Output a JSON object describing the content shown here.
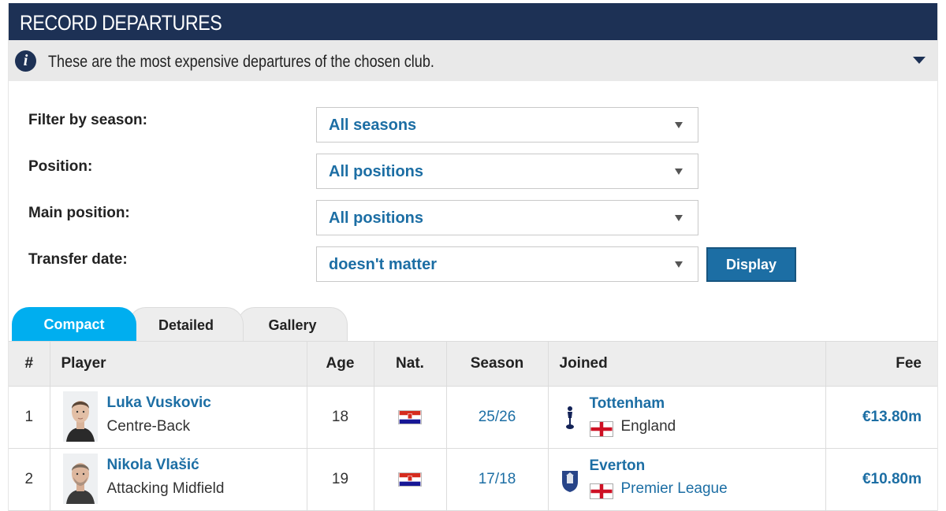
{
  "header": {
    "title": "RECORD DEPARTURES"
  },
  "info": {
    "icon": "info-icon",
    "text": "These are the most expensive departures of the chosen club."
  },
  "filters": [
    {
      "label": "Filter by season:",
      "value": "All seasons"
    },
    {
      "label": "Position:",
      "value": "All positions"
    },
    {
      "label": "Main position:",
      "value": "All positions"
    },
    {
      "label": "Transfer date:",
      "value": "doesn't matter"
    }
  ],
  "display_button": "Display",
  "tabs": [
    "Compact",
    "Detailed",
    "Gallery"
  ],
  "table": {
    "columns": [
      "#",
      "Player",
      "Age",
      "Nat.",
      "Season",
      "Joined",
      "Fee"
    ],
    "rows": [
      {
        "rank": "1",
        "name": "Luka Vuskovic",
        "position": "Centre-Back",
        "age": "18",
        "nationality_flag": "croatia-flag-icon",
        "season": "25/26",
        "club": "Tottenham",
        "club_sub": "England",
        "fee": "€13.80m"
      },
      {
        "rank": "2",
        "name": "Nikola Vlašić",
        "position": "Attacking Midfield",
        "age": "19",
        "nationality_flag": "croatia-flag-icon",
        "season": "17/18",
        "club": "Everton",
        "club_sub": "Premier League",
        "fee": "€10.80m"
      }
    ]
  },
  "colors": {
    "header_bg": "#1d3155",
    "link": "#1c6ea4",
    "active_tab": "#00aeef",
    "infobar_bg": "#e9e9e9"
  }
}
